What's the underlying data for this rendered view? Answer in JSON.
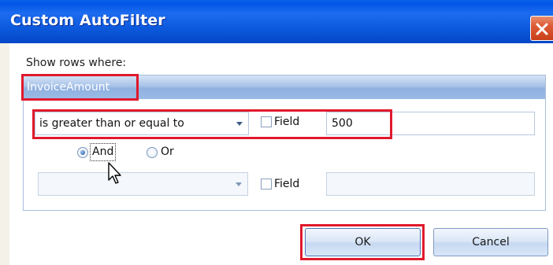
{
  "window": {
    "title": "Custom AutoFilter",
    "title_bar_color": "#0055e5",
    "close_color": "#dc5a34"
  },
  "filter": {
    "show_label": "Show rows where:",
    "column_name": "InvoiceAmount",
    "condition1": {
      "operator": "is greater than or equal to",
      "field_checkbox_label": "Field",
      "field_checked": false,
      "value": "500"
    },
    "logic": {
      "and_label": "And",
      "or_label": "Or",
      "selected": "And"
    },
    "condition2": {
      "operator": "",
      "field_checkbox_label": "Field",
      "field_checked": false,
      "value": ""
    }
  },
  "buttons": {
    "ok_label": "OK",
    "cancel_label": "Cancel"
  },
  "annotation_color": "#e0192c",
  "cursor_icon": "arrow-pointer-icon"
}
